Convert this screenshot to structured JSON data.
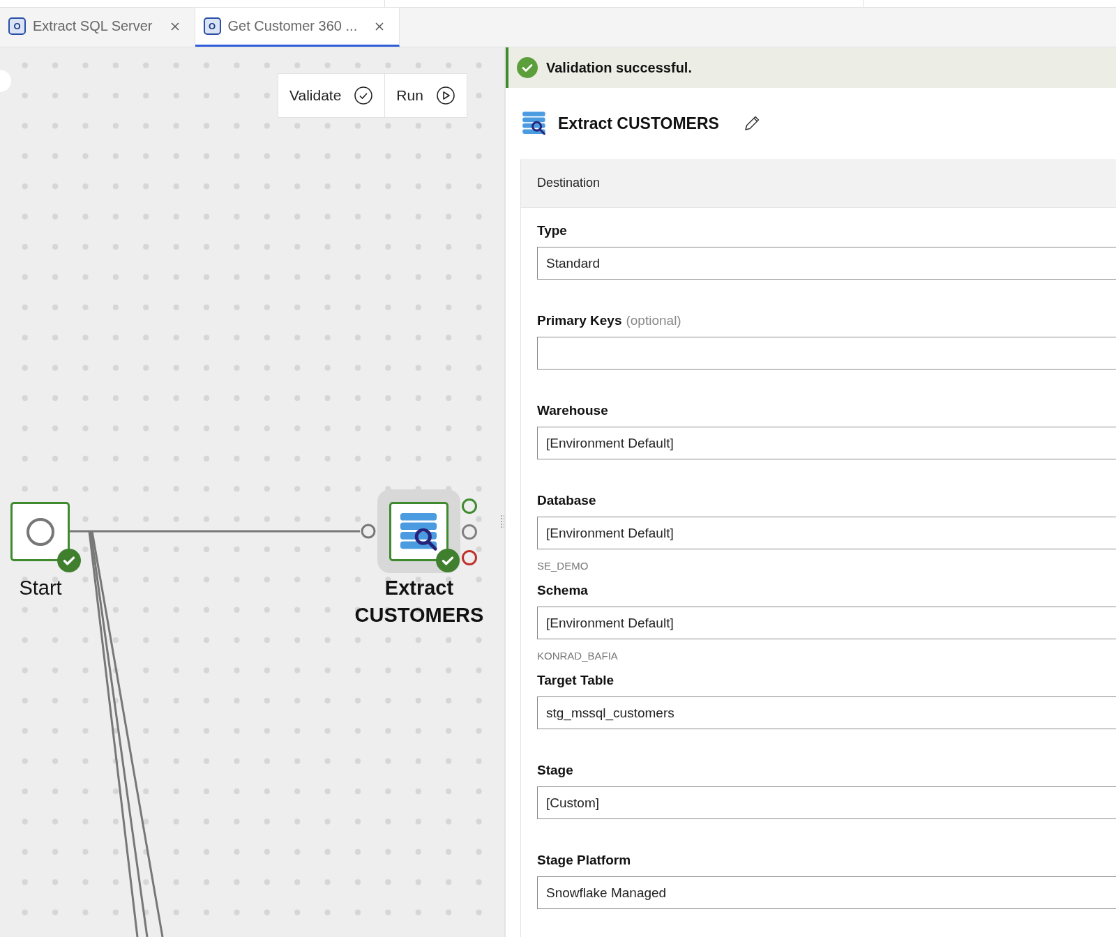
{
  "tabs": [
    {
      "label": "Extract SQL Server",
      "icon_letter": "O",
      "selected": false
    },
    {
      "label": "Get Customer 360 ...",
      "icon_letter": "O",
      "selected": true
    }
  ],
  "toolbar": [
    {
      "label": "Validate",
      "kind": "validate"
    },
    {
      "label": "Run",
      "kind": "run"
    }
  ],
  "canvas": {
    "nodes": [
      {
        "kind": "start",
        "label_lines": [
          "Start"
        ],
        "valid": true,
        "selected": false
      },
      {
        "kind": "extract",
        "label_lines": [
          "Extract",
          "CUSTOMERS"
        ],
        "valid": true,
        "selected": true,
        "ports": [
          {
            "color": "#3f8a2f"
          },
          {
            "color": "#808080"
          },
          {
            "color": "#c0302b"
          }
        ]
      }
    ]
  },
  "notification": {
    "message": "Validation successful."
  },
  "panel": {
    "title": "Extract CUSTOMERS",
    "section": "Destination",
    "fields": [
      {
        "label": "Type",
        "value": "Standard"
      },
      {
        "label": "Primary Keys",
        "note": "(optional)"
      },
      {
        "label": "Warehouse",
        "value": "[Environment Default]"
      },
      {
        "label": "Database",
        "value": "[Environment Default]",
        "hint": "SE_DEMO"
      },
      {
        "label": "Schema",
        "value": "[Environment Default]",
        "hint": "KONRAD_BAFIA"
      },
      {
        "label": "Target Table",
        "value": "stg_mssql_customers"
      },
      {
        "label": "Stage",
        "value": "[Custom]"
      },
      {
        "label": "Stage Platform",
        "value": "Snowflake Managed"
      }
    ]
  }
}
